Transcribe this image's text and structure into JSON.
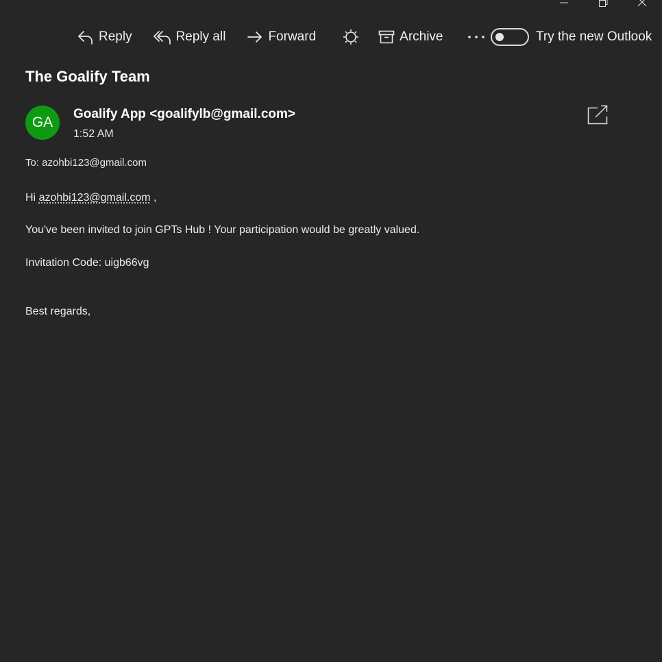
{
  "toolbar": {
    "reply_label": "Reply",
    "reply_all_label": "Reply all",
    "forward_label": "Forward",
    "archive_label": "Archive",
    "try_new_outlook_label": "Try the new Outlook"
  },
  "message": {
    "subject": "The Goalify Team",
    "sender_initials": "GA",
    "sender": "Goalify App <goalifylb@gmail.com>",
    "time": "1:52 AM",
    "to_line": "To: azohbi123@gmail.com",
    "greeting_prefix": "Hi",
    "greeting_email": "azohbi123@gmail.com",
    "greeting_suffix": ",",
    "invite_line": "You've been invited to join GPTs Hub ! Your participation would be greatly valued.",
    "invitation_code_line": "Invitation Code: uigb66vg",
    "signoff": "Best regards,"
  },
  "colors": {
    "background": "#262626",
    "avatar": "#0e9a12",
    "text": "#e6e6e6"
  },
  "icons": {
    "reply": "reply-icon",
    "reply_all": "reply-all-icon",
    "forward": "forward-icon",
    "sweep": "sweep-icon",
    "archive": "archive-icon",
    "more": "more-icon",
    "popout": "open-in-new-window-icon",
    "minimize": "minimize-icon",
    "restore": "restore-icon",
    "close": "close-icon"
  },
  "toggles": {
    "try_new_outlook_on": false
  }
}
